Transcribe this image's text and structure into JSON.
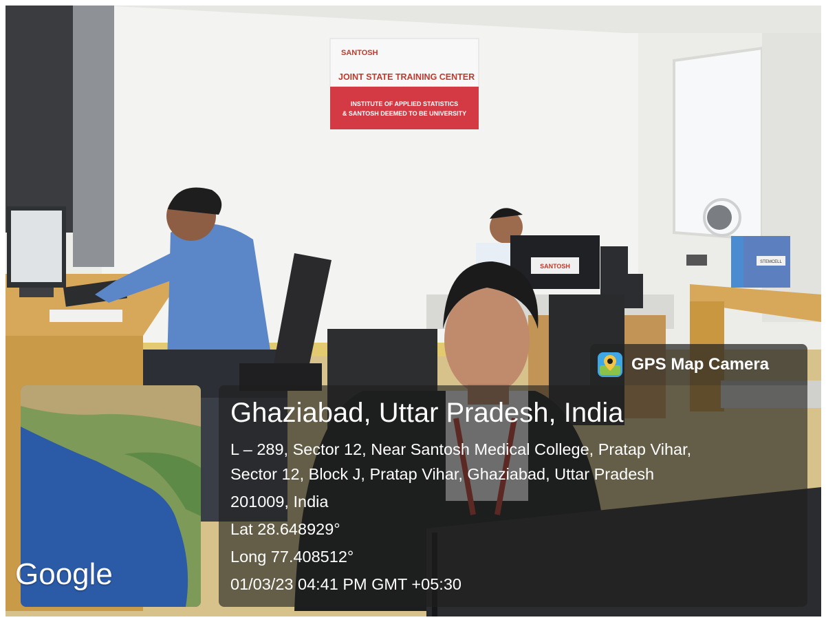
{
  "sign": {
    "brand": "SANTOSH",
    "heading": "JOINT STATE TRAINING CENTER",
    "line1": "INSTITUTE OF APPLIED STATISTICS",
    "line2": "& SANTOSH DEEMED TO BE UNIVERSITY"
  },
  "monitor_sticker": "SANTOSH",
  "binder_label": "STEMCELL",
  "gps": {
    "app_name": "GPS Map Camera",
    "location_title": "Ghaziabad, Uttar Pradesh, India",
    "address_line1": "L – 289, Sector 12, Near Santosh Medical College, Pratap Vihar,",
    "address_line2": "Sector 12, Block J, Pratap Vihar, Ghaziabad, Uttar Pradesh",
    "address_line3": "201009, India",
    "latitude": "Lat 28.648929°",
    "longitude": "Long 77.408512°",
    "timestamp": "01/03/23 04:41 PM GMT +05:30"
  },
  "map": {
    "provider": "Google"
  },
  "colors": {
    "wall": "#ecece9",
    "desk": "#d7a85a",
    "sign_red": "#d43a43",
    "shirt_blue": "#5b86c8",
    "overlay": "#1e1e1e"
  }
}
